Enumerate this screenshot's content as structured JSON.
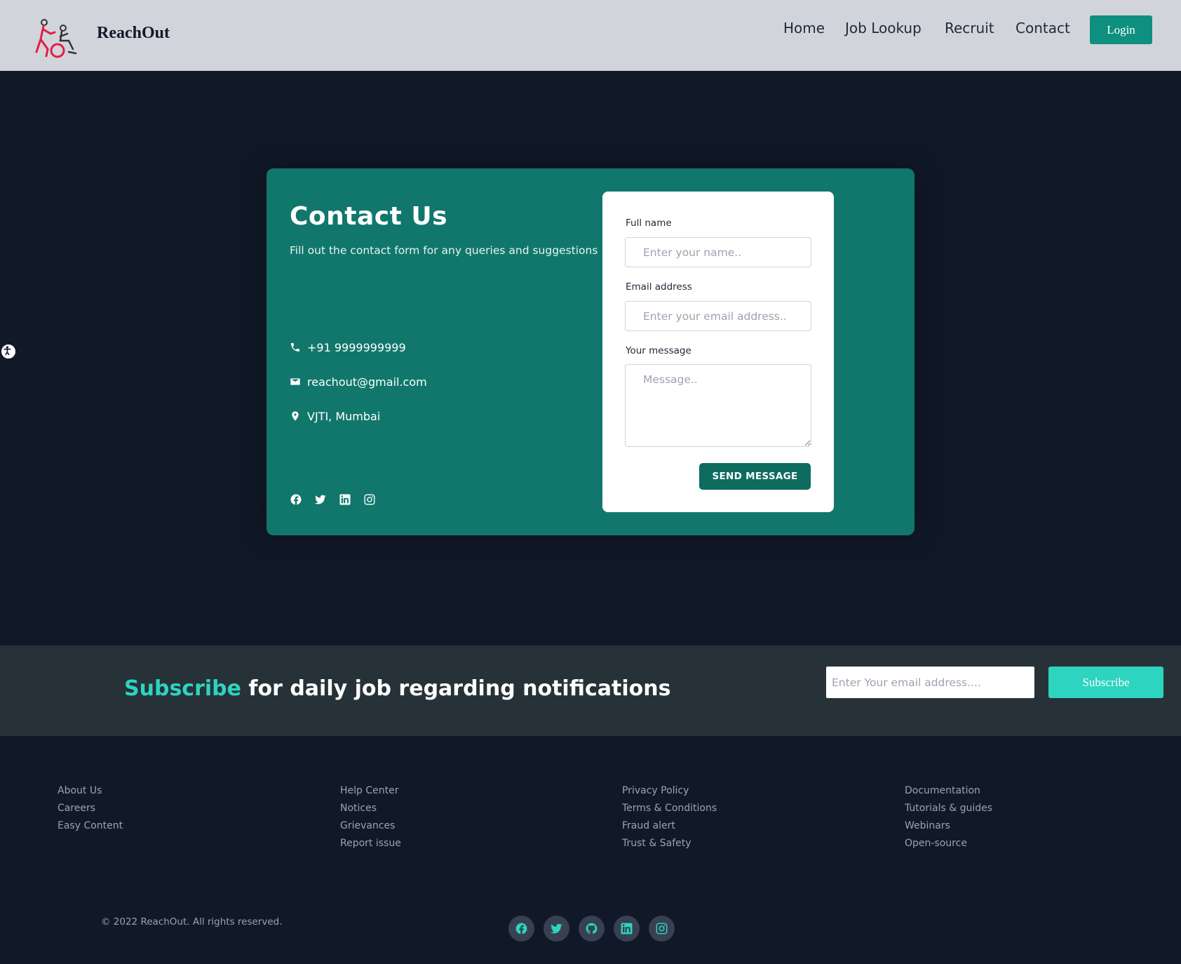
{
  "header": {
    "brand": "ReachOut",
    "nav": [
      "Home",
      "Job Lookup",
      "Recruit",
      "Contact"
    ],
    "login_label": "Login"
  },
  "contact": {
    "title": "Contact Us",
    "subtitle": "Fill out the contact form for any queries and suggestions",
    "phone": "+91 9999999999",
    "email": "reachout@gmail.com",
    "location": "VJTI, Mumbai",
    "social_icons": [
      "facebook-icon",
      "twitter-icon",
      "linkedin-icon",
      "instagram-icon"
    ]
  },
  "form": {
    "name_label": "Full name",
    "name_placeholder": "Enter your name..",
    "email_label": "Email address",
    "email_placeholder": "Enter your email address..",
    "message_label": "Your message",
    "message_placeholder": "Message..",
    "send_label": "SEND MESSAGE"
  },
  "subscribe": {
    "highlight": "Subscribe",
    "text": " for daily job regarding notifications",
    "placeholder": "Enter Your email address....",
    "button_label": "Subscribe"
  },
  "footer": {
    "columns": [
      [
        "About Us",
        "Careers",
        "Easy Content"
      ],
      [
        "Help Center",
        "Notices",
        "Grievances",
        "Report issue"
      ],
      [
        "Privacy Policy",
        "Terms & Conditions",
        "Fraud alert",
        "Trust & Safety"
      ],
      [
        "Documentation",
        "Tutorials & guides",
        "Webinars",
        "Open-source"
      ]
    ],
    "copyright": "© 2022 ReachOut. All rights reserved.",
    "social_icons": [
      "facebook-icon",
      "twitter-icon",
      "github-icon",
      "linkedin-icon",
      "instagram-icon"
    ]
  },
  "colors": {
    "page_bg": "#111827",
    "header_bg": "#d1d5db",
    "card_bg": "#11776c",
    "accent": "#2dd4bf",
    "button": "#0f8f7f"
  }
}
